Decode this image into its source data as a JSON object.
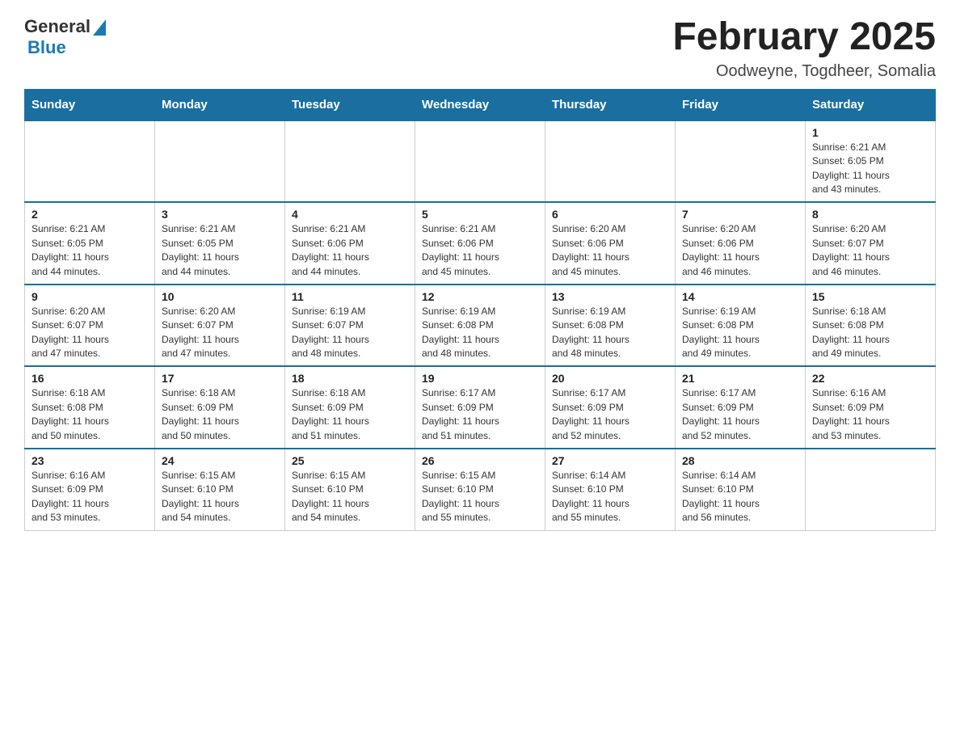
{
  "header": {
    "logo_general": "General",
    "logo_blue": "Blue",
    "month_title": "February 2025",
    "location": "Oodweyne, Togdheer, Somalia"
  },
  "days_of_week": [
    "Sunday",
    "Monday",
    "Tuesday",
    "Wednesday",
    "Thursday",
    "Friday",
    "Saturday"
  ],
  "weeks": [
    [
      {
        "day": "",
        "info": ""
      },
      {
        "day": "",
        "info": ""
      },
      {
        "day": "",
        "info": ""
      },
      {
        "day": "",
        "info": ""
      },
      {
        "day": "",
        "info": ""
      },
      {
        "day": "",
        "info": ""
      },
      {
        "day": "1",
        "info": "Sunrise: 6:21 AM\nSunset: 6:05 PM\nDaylight: 11 hours\nand 43 minutes."
      }
    ],
    [
      {
        "day": "2",
        "info": "Sunrise: 6:21 AM\nSunset: 6:05 PM\nDaylight: 11 hours\nand 44 minutes."
      },
      {
        "day": "3",
        "info": "Sunrise: 6:21 AM\nSunset: 6:05 PM\nDaylight: 11 hours\nand 44 minutes."
      },
      {
        "day": "4",
        "info": "Sunrise: 6:21 AM\nSunset: 6:06 PM\nDaylight: 11 hours\nand 44 minutes."
      },
      {
        "day": "5",
        "info": "Sunrise: 6:21 AM\nSunset: 6:06 PM\nDaylight: 11 hours\nand 45 minutes."
      },
      {
        "day": "6",
        "info": "Sunrise: 6:20 AM\nSunset: 6:06 PM\nDaylight: 11 hours\nand 45 minutes."
      },
      {
        "day": "7",
        "info": "Sunrise: 6:20 AM\nSunset: 6:06 PM\nDaylight: 11 hours\nand 46 minutes."
      },
      {
        "day": "8",
        "info": "Sunrise: 6:20 AM\nSunset: 6:07 PM\nDaylight: 11 hours\nand 46 minutes."
      }
    ],
    [
      {
        "day": "9",
        "info": "Sunrise: 6:20 AM\nSunset: 6:07 PM\nDaylight: 11 hours\nand 47 minutes."
      },
      {
        "day": "10",
        "info": "Sunrise: 6:20 AM\nSunset: 6:07 PM\nDaylight: 11 hours\nand 47 minutes."
      },
      {
        "day": "11",
        "info": "Sunrise: 6:19 AM\nSunset: 6:07 PM\nDaylight: 11 hours\nand 48 minutes."
      },
      {
        "day": "12",
        "info": "Sunrise: 6:19 AM\nSunset: 6:08 PM\nDaylight: 11 hours\nand 48 minutes."
      },
      {
        "day": "13",
        "info": "Sunrise: 6:19 AM\nSunset: 6:08 PM\nDaylight: 11 hours\nand 48 minutes."
      },
      {
        "day": "14",
        "info": "Sunrise: 6:19 AM\nSunset: 6:08 PM\nDaylight: 11 hours\nand 49 minutes."
      },
      {
        "day": "15",
        "info": "Sunrise: 6:18 AM\nSunset: 6:08 PM\nDaylight: 11 hours\nand 49 minutes."
      }
    ],
    [
      {
        "day": "16",
        "info": "Sunrise: 6:18 AM\nSunset: 6:08 PM\nDaylight: 11 hours\nand 50 minutes."
      },
      {
        "day": "17",
        "info": "Sunrise: 6:18 AM\nSunset: 6:09 PM\nDaylight: 11 hours\nand 50 minutes."
      },
      {
        "day": "18",
        "info": "Sunrise: 6:18 AM\nSunset: 6:09 PM\nDaylight: 11 hours\nand 51 minutes."
      },
      {
        "day": "19",
        "info": "Sunrise: 6:17 AM\nSunset: 6:09 PM\nDaylight: 11 hours\nand 51 minutes."
      },
      {
        "day": "20",
        "info": "Sunrise: 6:17 AM\nSunset: 6:09 PM\nDaylight: 11 hours\nand 52 minutes."
      },
      {
        "day": "21",
        "info": "Sunrise: 6:17 AM\nSunset: 6:09 PM\nDaylight: 11 hours\nand 52 minutes."
      },
      {
        "day": "22",
        "info": "Sunrise: 6:16 AM\nSunset: 6:09 PM\nDaylight: 11 hours\nand 53 minutes."
      }
    ],
    [
      {
        "day": "23",
        "info": "Sunrise: 6:16 AM\nSunset: 6:09 PM\nDaylight: 11 hours\nand 53 minutes."
      },
      {
        "day": "24",
        "info": "Sunrise: 6:15 AM\nSunset: 6:10 PM\nDaylight: 11 hours\nand 54 minutes."
      },
      {
        "day": "25",
        "info": "Sunrise: 6:15 AM\nSunset: 6:10 PM\nDaylight: 11 hours\nand 54 minutes."
      },
      {
        "day": "26",
        "info": "Sunrise: 6:15 AM\nSunset: 6:10 PM\nDaylight: 11 hours\nand 55 minutes."
      },
      {
        "day": "27",
        "info": "Sunrise: 6:14 AM\nSunset: 6:10 PM\nDaylight: 11 hours\nand 55 minutes."
      },
      {
        "day": "28",
        "info": "Sunrise: 6:14 AM\nSunset: 6:10 PM\nDaylight: 11 hours\nand 56 minutes."
      },
      {
        "day": "",
        "info": ""
      }
    ]
  ]
}
